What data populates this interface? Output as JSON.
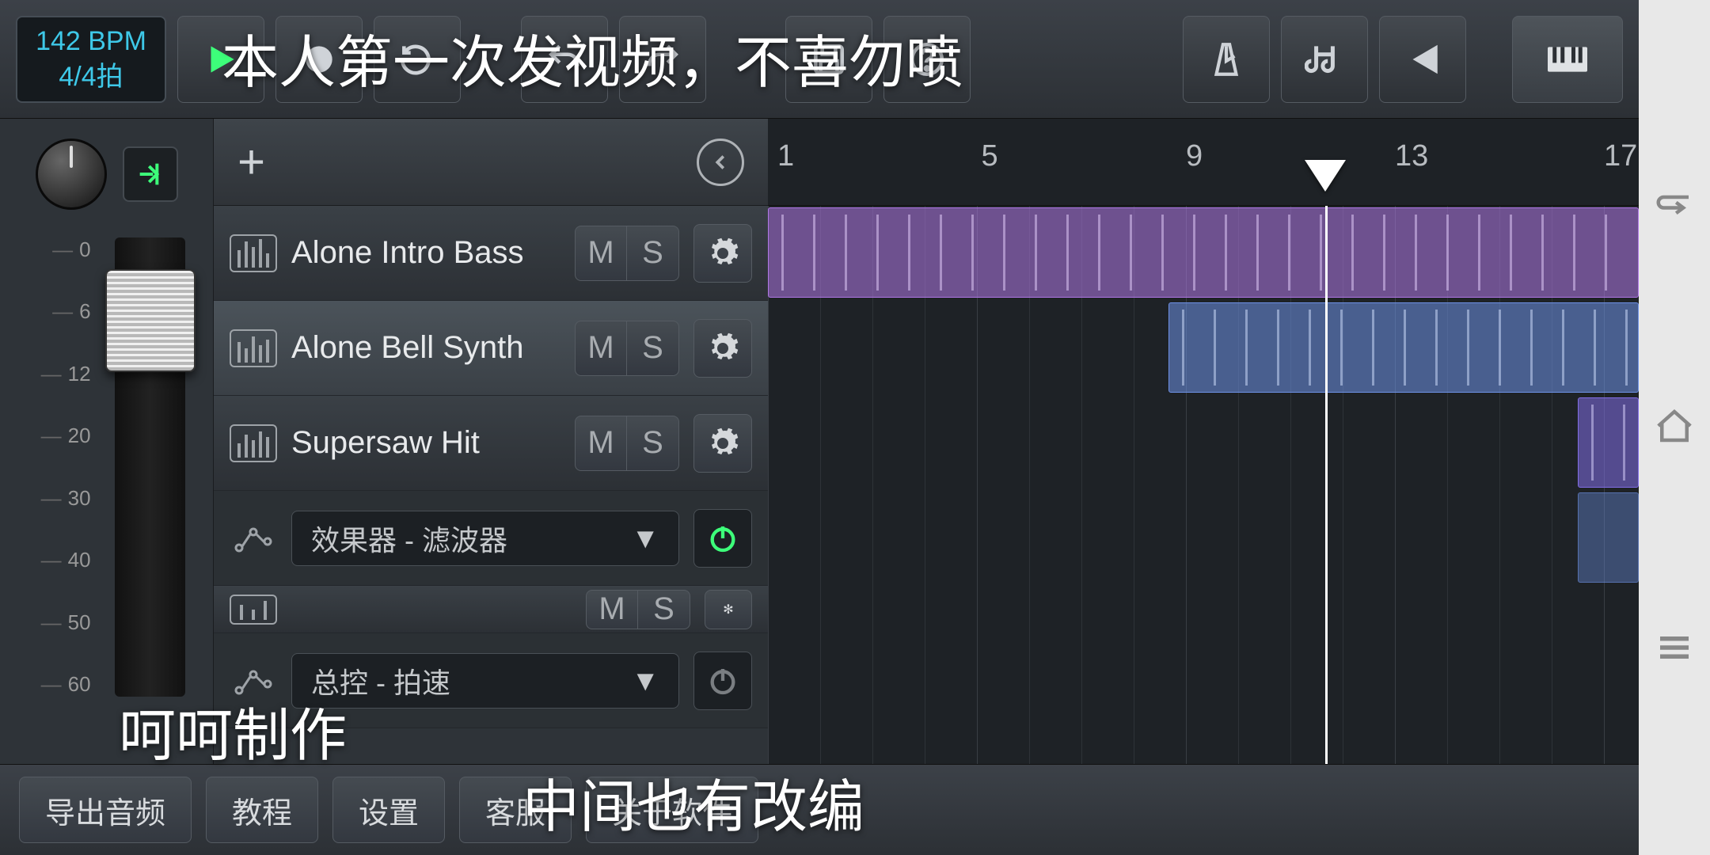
{
  "tempo": {
    "bpm": "142 BPM",
    "sig": "4/4拍"
  },
  "ruler": {
    "marks": [
      "1",
      "5",
      "9",
      "13",
      "17"
    ],
    "playhead_bar": 11.7
  },
  "db_marks": [
    "0",
    "6",
    "12",
    "20",
    "30",
    "40",
    "50",
    "60"
  ],
  "tracks": [
    {
      "name": "Alone Intro Bass",
      "type": "instr",
      "m": "M",
      "s": "S",
      "selected": false
    },
    {
      "name": "Alone Bell Synth",
      "type": "instr",
      "m": "M",
      "s": "S",
      "selected": true
    },
    {
      "name": "Supersaw Hit",
      "type": "instr",
      "m": "M",
      "s": "S",
      "selected": false
    },
    {
      "name": "效果器 - 滤波器",
      "type": "auto",
      "power": "on"
    },
    {
      "name": "",
      "type": "instr_cut",
      "m": "M",
      "s": "S"
    },
    {
      "name": "总控 - 拍速",
      "type": "auto",
      "power": "off"
    }
  ],
  "bottom_buttons": [
    "导出音频",
    "教程",
    "设置",
    "客服",
    "关于软件"
  ],
  "subtitles": {
    "top": "本人第一次发视频，不喜勿喷",
    "mid": "呵呵制作",
    "low": "中间也有改编"
  },
  "clips": [
    {
      "row": 0,
      "start": 1,
      "end": 17.5,
      "color": "purple"
    },
    {
      "row": 1,
      "start": 8.5,
      "end": 17.5,
      "color": "blue"
    },
    {
      "row": 2,
      "start": 16,
      "end": 17.5,
      "color": "violet"
    },
    {
      "row": 3,
      "start": 16,
      "end": 17.5,
      "color": "blue"
    }
  ]
}
